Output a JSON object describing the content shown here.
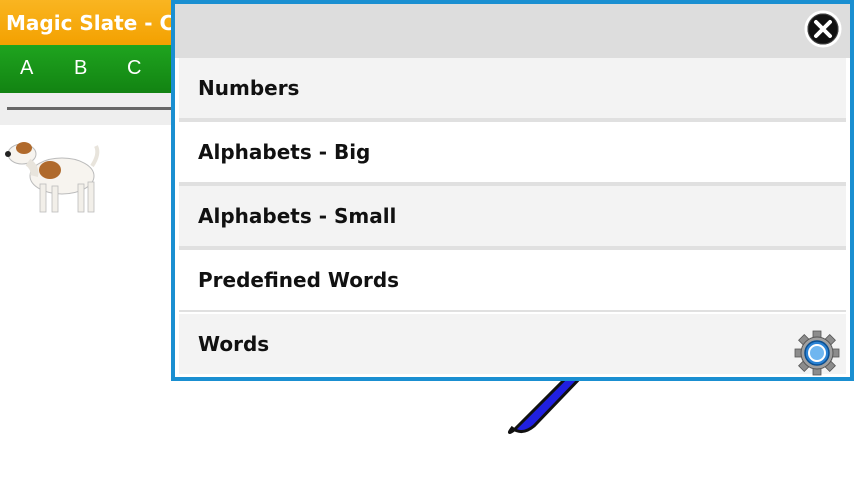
{
  "app": {
    "title": "Magic Slate - Curs",
    "letters": [
      "A",
      "B",
      "C"
    ]
  },
  "dialog": {
    "items": [
      {
        "label": "Numbers"
      },
      {
        "label": "Alphabets - Big"
      },
      {
        "label": "Alphabets - Small"
      },
      {
        "label": "Predefined Words"
      },
      {
        "label": "Words"
      }
    ],
    "close_icon": "close-icon",
    "settings_icon": "gear-icon"
  },
  "colors": {
    "title_bar": "#f4a100",
    "letter_bar": "#128312",
    "dialog_border": "#1a8fd1",
    "pen": "#2020e0"
  }
}
